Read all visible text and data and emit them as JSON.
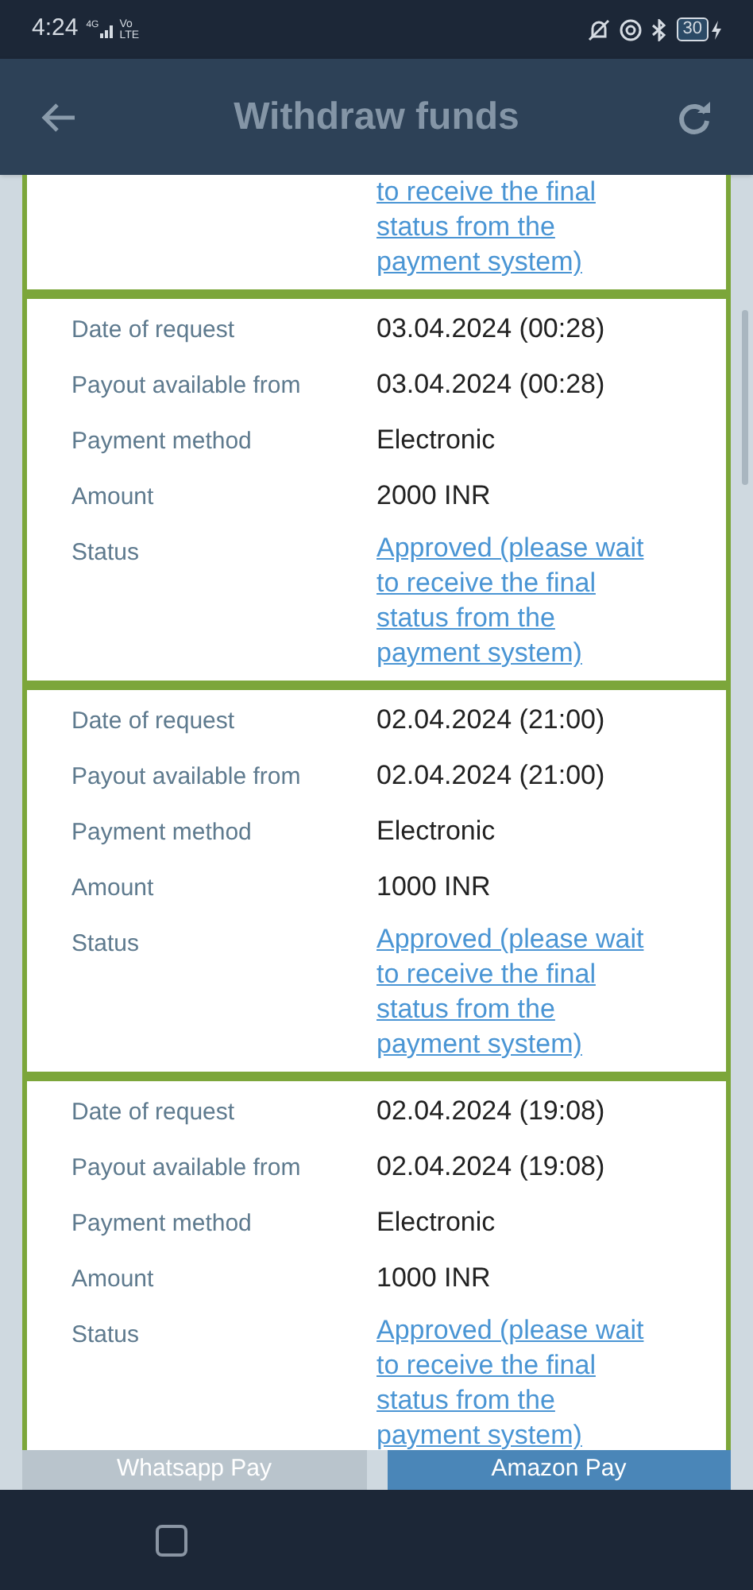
{
  "status_bar": {
    "time": "4:24",
    "network": "4G",
    "volte": "Vo LTE",
    "battery": "30"
  },
  "header": {
    "title": "Withdraw funds"
  },
  "requests": [
    {
      "kind": "partial",
      "status": [
        "to receive the final",
        "status from the",
        "payment system)"
      ]
    },
    {
      "kind": "full",
      "labels": [
        "Date of request",
        "Payout available from",
        "Payment method",
        "Amount",
        "Status"
      ],
      "date": "03.04.2024 (00:28)",
      "available": "03.04.2024 (00:28)",
      "method": "Electronic",
      "amount": "2000 INR",
      "status": [
        "Approved (please wait",
        "to receive the final",
        "status from the",
        "payment system)"
      ]
    },
    {
      "kind": "full",
      "labels": [
        "Date of request",
        "Payout available from",
        "Payment method",
        "Amount",
        "Status"
      ],
      "date": "02.04.2024 (21:00)",
      "available": "02.04.2024 (21:00)",
      "method": "Electronic",
      "amount": "1000 INR",
      "status": [
        "Approved (please wait",
        "to receive the final",
        "status from the",
        "payment system)"
      ]
    },
    {
      "kind": "full",
      "labels": [
        "Date of request",
        "Payout available from",
        "Payment method",
        "Amount",
        "Status"
      ],
      "date": "02.04.2024 (19:08)",
      "available": "02.04.2024 (19:08)",
      "method": "Electronic",
      "amount": "1000 INR",
      "status": [
        "Approved (please wait",
        "to receive the final",
        "status from the",
        "payment system)"
      ]
    }
  ],
  "tabs": [
    {
      "label": "Whatsapp Pay",
      "selected": false
    },
    {
      "label": "Amazon Pay",
      "selected": true
    }
  ]
}
